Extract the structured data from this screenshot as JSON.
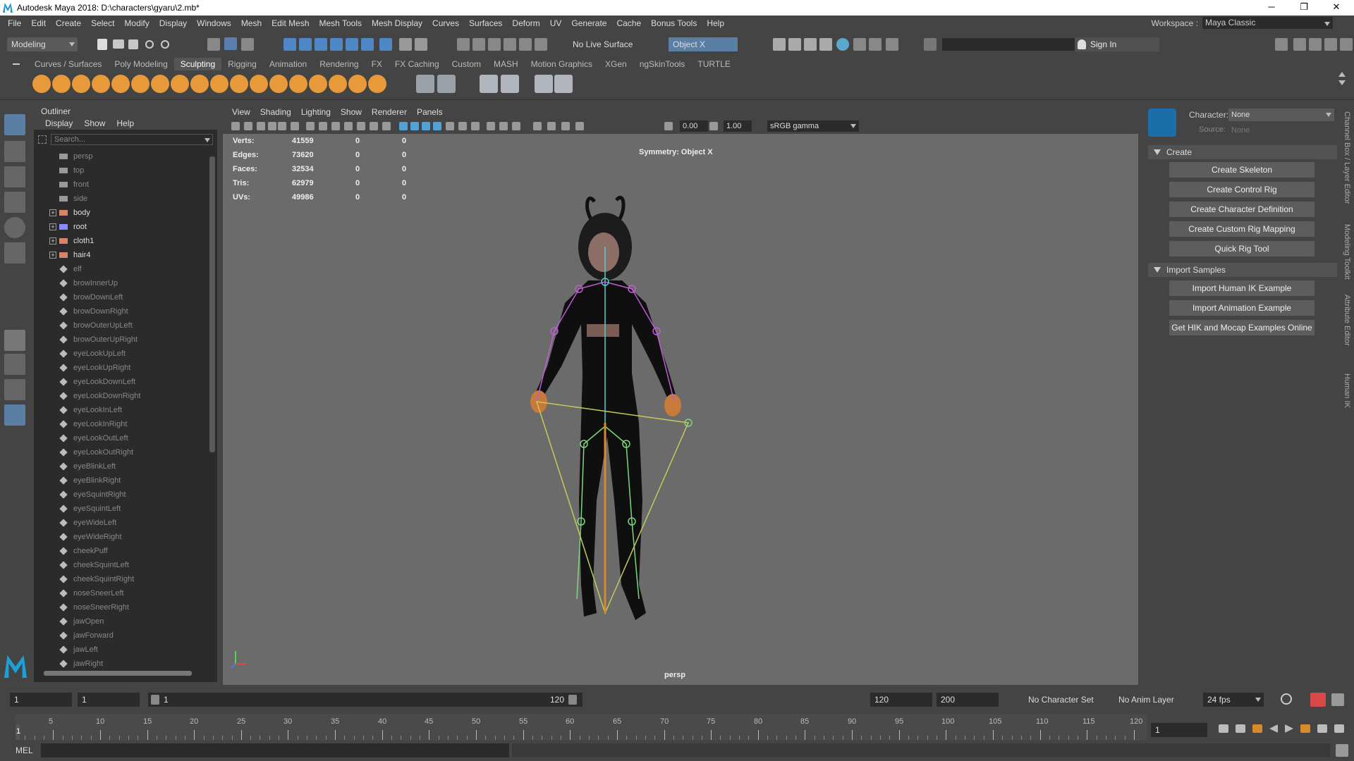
{
  "window": {
    "title": "Autodesk Maya 2018: D:\\characters\\gyaru\\2.mb*",
    "minimize": "─",
    "maximize": "❐",
    "close": "✕"
  },
  "menubar": [
    "File",
    "Edit",
    "Create",
    "Select",
    "Modify",
    "Display",
    "Windows",
    "Mesh",
    "Edit Mesh",
    "Mesh Tools",
    "Mesh Display",
    "Curves",
    "Surfaces",
    "Deform",
    "UV",
    "Generate",
    "Cache",
    "Bonus Tools",
    "Help"
  ],
  "workspace": {
    "label": "Workspace :",
    "value": "Maya Classic"
  },
  "statusline": {
    "mode": "Modeling",
    "live_surface": "No Live Surface",
    "symmetry": "Object X",
    "signin": "Sign In"
  },
  "shelf_tabs": [
    "Curves / Surfaces",
    "Poly Modeling",
    "Sculpting",
    "Rigging",
    "Animation",
    "Rendering",
    "FX",
    "FX Caching",
    "Custom",
    "MASH",
    "Motion Graphics",
    "XGen",
    "ngSkinTools",
    "TURTLE"
  ],
  "shelf_active": "Sculpting",
  "outliner": {
    "title": "Outliner",
    "menu": [
      "Display",
      "Show",
      "Help"
    ],
    "search_placeholder": "Search...",
    "items": [
      {
        "label": "persp",
        "type": "camera",
        "style": "dim"
      },
      {
        "label": "top",
        "type": "camera",
        "style": "dim"
      },
      {
        "label": "front",
        "type": "camera",
        "style": "dim"
      },
      {
        "label": "side",
        "type": "camera",
        "style": "dim"
      },
      {
        "label": "body",
        "type": "mesh",
        "style": "bright",
        "expand": true
      },
      {
        "label": "root",
        "type": "joint",
        "style": "bright",
        "expand": true
      },
      {
        "label": "cloth1",
        "type": "mesh",
        "style": "bright",
        "expand": true
      },
      {
        "label": "hair4",
        "type": "mesh",
        "style": "bright",
        "expand": true
      },
      {
        "label": "elf",
        "type": "blend",
        "style": "dim"
      },
      {
        "label": "browInnerUp",
        "type": "blend",
        "style": "dim"
      },
      {
        "label": "browDownLeft",
        "type": "blend",
        "style": "dim"
      },
      {
        "label": "browDownRight",
        "type": "blend",
        "style": "dim"
      },
      {
        "label": "browOuterUpLeft",
        "type": "blend",
        "style": "dim"
      },
      {
        "label": "browOuterUpRight",
        "type": "blend",
        "style": "dim"
      },
      {
        "label": "eyeLookUpLeft",
        "type": "blend",
        "style": "dim"
      },
      {
        "label": "eyeLookUpRight",
        "type": "blend",
        "style": "dim"
      },
      {
        "label": "eyeLookDownLeft",
        "type": "blend",
        "style": "dim"
      },
      {
        "label": "eyeLookDownRight",
        "type": "blend",
        "style": "dim"
      },
      {
        "label": "eyeLookInLeft",
        "type": "blend",
        "style": "dim"
      },
      {
        "label": "eyeLookInRight",
        "type": "blend",
        "style": "dim"
      },
      {
        "label": "eyeLookOutLeft",
        "type": "blend",
        "style": "dim"
      },
      {
        "label": "eyeLookOutRight",
        "type": "blend",
        "style": "dim"
      },
      {
        "label": "eyeBlinkLeft",
        "type": "blend",
        "style": "dim"
      },
      {
        "label": "eyeBlinkRight",
        "type": "blend",
        "style": "dim"
      },
      {
        "label": "eyeSquintRight",
        "type": "blend",
        "style": "dim"
      },
      {
        "label": "eyeSquintLeft",
        "type": "blend",
        "style": "dim"
      },
      {
        "label": "eyeWideLeft",
        "type": "blend",
        "style": "dim"
      },
      {
        "label": "eyeWideRight",
        "type": "blend",
        "style": "dim"
      },
      {
        "label": "cheekPuff",
        "type": "blend",
        "style": "dim"
      },
      {
        "label": "cheekSquintLeft",
        "type": "blend",
        "style": "dim"
      },
      {
        "label": "cheekSquintRight",
        "type": "blend",
        "style": "dim"
      },
      {
        "label": "noseSneerLeft",
        "type": "blend",
        "style": "dim"
      },
      {
        "label": "noseSneerRight",
        "type": "blend",
        "style": "dim"
      },
      {
        "label": "jawOpen",
        "type": "blend",
        "style": "dim"
      },
      {
        "label": "jawForward",
        "type": "blend",
        "style": "dim"
      },
      {
        "label": "jawLeft",
        "type": "blend",
        "style": "dim"
      },
      {
        "label": "jawRight",
        "type": "blend",
        "style": "dim"
      }
    ]
  },
  "viewport": {
    "menu": [
      "View",
      "Shading",
      "Lighting",
      "Show",
      "Renderer",
      "Panels"
    ],
    "exposure": "0.00",
    "gamma": "1.00",
    "colorspace": "sRGB gamma",
    "hud": [
      {
        "k": "Verts:",
        "v": "41559",
        "a": "0",
        "b": "0"
      },
      {
        "k": "Edges:",
        "v": "73620",
        "a": "0",
        "b": "0"
      },
      {
        "k": "Faces:",
        "v": "32534",
        "a": "0",
        "b": "0"
      },
      {
        "k": "Tris:",
        "v": "62979",
        "a": "0",
        "b": "0"
      },
      {
        "k": "UVs:",
        "v": "49986",
        "a": "0",
        "b": "0"
      }
    ],
    "symmetry_text": "Symmetry: Object X",
    "camera": "persp"
  },
  "hik": {
    "character_label": "Character:",
    "character_value": "None",
    "source_label": "Source:",
    "source_value": "None",
    "create_title": "Create",
    "create_buttons": [
      "Create Skeleton",
      "Create Control Rig",
      "Create Character Definition",
      "Create Custom Rig Mapping",
      "Quick Rig Tool"
    ],
    "import_title": "Import Samples",
    "import_buttons": [
      "Import Human IK Example",
      "Import Animation Example",
      "Get HIK and Mocap Examples Online"
    ]
  },
  "side_tabs": [
    "Channel Box / Layer Editor",
    "Modeling Toolkit",
    "Attribute Editor",
    "Human IK"
  ],
  "range": {
    "start": "1",
    "anim_start": "1",
    "range_start": "1",
    "range_end": "120",
    "anim_end": "120",
    "end": "200",
    "character_set": "No Character Set",
    "anim_layer": "No Anim Layer",
    "fps": "24 fps"
  },
  "timeline": {
    "labels": [
      "5",
      "10",
      "15",
      "20",
      "25",
      "30",
      "35",
      "40",
      "45",
      "50",
      "55",
      "60",
      "65",
      "70",
      "75",
      "80",
      "85",
      "90",
      "95",
      "100",
      "105",
      "110",
      "115",
      "120"
    ],
    "current": "1",
    "current_field": "1"
  },
  "cmdline": {
    "label": "MEL"
  }
}
